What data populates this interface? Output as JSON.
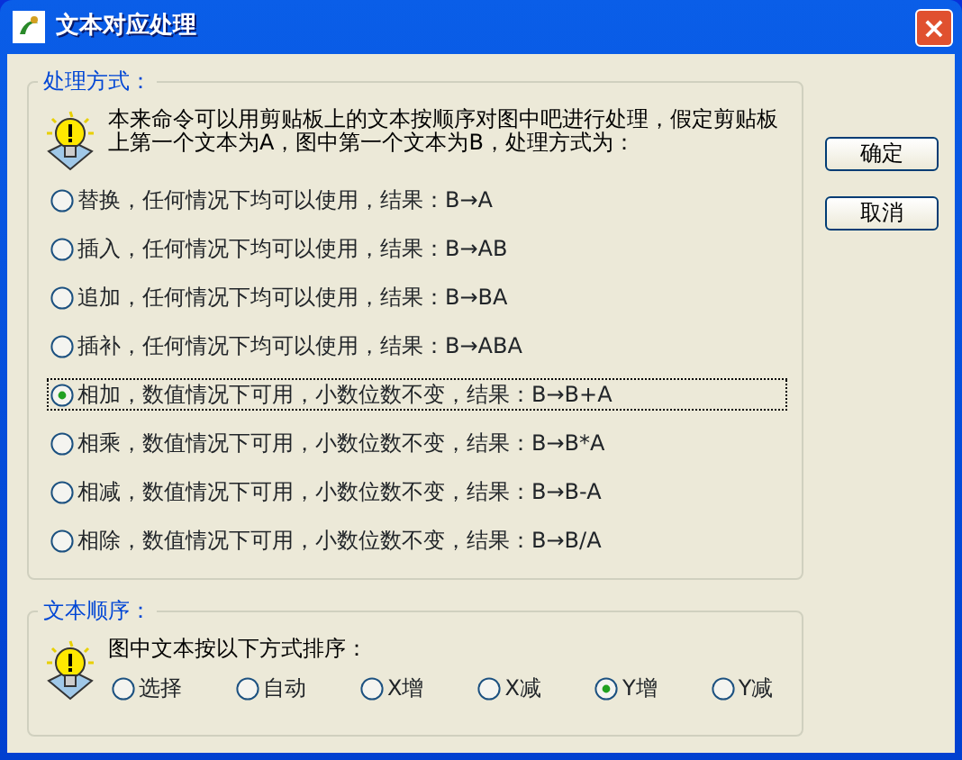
{
  "window": {
    "title": "文本对应处理",
    "close": "×"
  },
  "mode_group": {
    "title": "处理方式：",
    "note": "本来命令可以用剪贴板上的文本按顺序对图中吧进行处理，假定剪贴板上第一个文本为A，图中第一个文本为B，处理方式为：",
    "options": [
      {
        "label": "替换，任何情况下均可以使用，结果：B→A",
        "selected": false
      },
      {
        "label": "插入，任何情况下均可以使用，结果：B→AB",
        "selected": false
      },
      {
        "label": "追加，任何情况下均可以使用，结果：B→BA",
        "selected": false
      },
      {
        "label": "插补，任何情况下均可以使用，结果：B→ABA",
        "selected": false
      },
      {
        "label": "相加，数值情况下可用，小数位数不变，结果：B→B+A",
        "selected": true
      },
      {
        "label": "相乘，数值情况下可用，小数位数不变，结果：B→B*A",
        "selected": false
      },
      {
        "label": "相减，数值情况下可用，小数位数不变，结果：B→B-A",
        "selected": false
      },
      {
        "label": "相除，数值情况下可用，小数位数不变，结果：B→B/A",
        "selected": false
      }
    ]
  },
  "order_group": {
    "title": "文本顺序：",
    "note": "图中文本按以下方式排序：",
    "options": [
      {
        "label": "选择",
        "selected": false
      },
      {
        "label": "自动",
        "selected": false
      },
      {
        "label": "X增",
        "selected": false
      },
      {
        "label": "X减",
        "selected": false
      },
      {
        "label": "Y增",
        "selected": true
      },
      {
        "label": "Y减",
        "selected": false
      }
    ]
  },
  "buttons": [
    "确定",
    "取消"
  ]
}
